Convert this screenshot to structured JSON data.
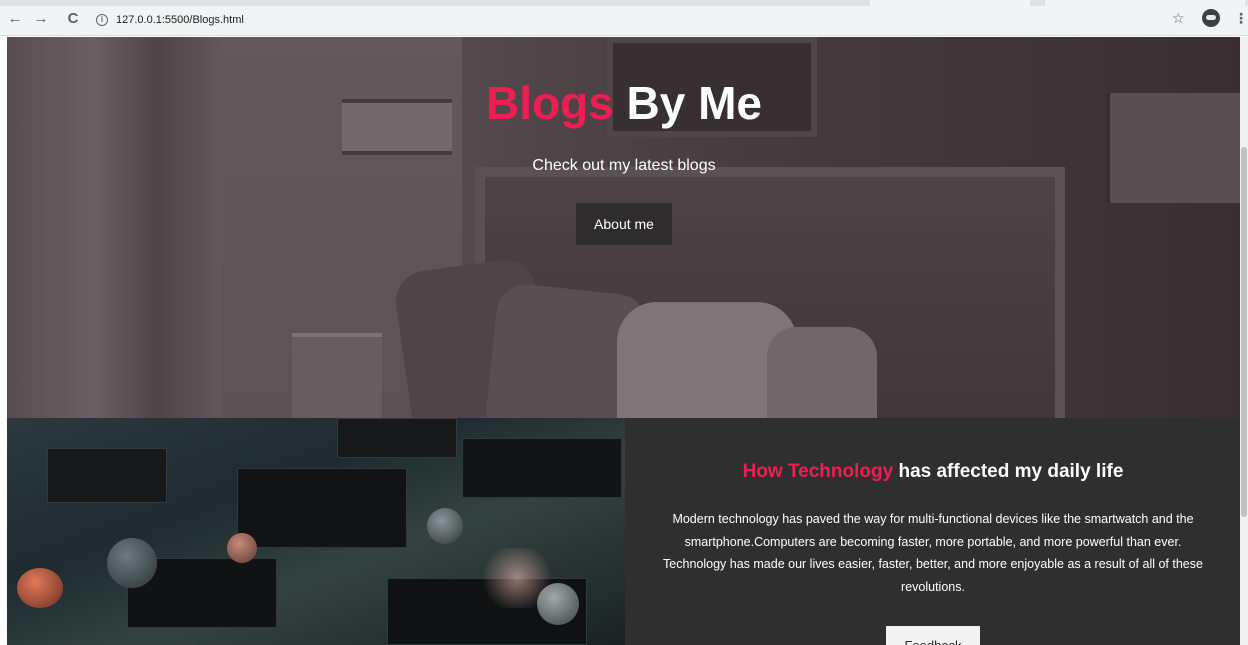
{
  "browser": {
    "url": "127.0.0.1:5500/Blogs.html",
    "back_glyph": "←",
    "forward_glyph": "→",
    "reload_glyph": "C",
    "info_glyph": "i",
    "star_glyph": "☆",
    "menu_glyph": "⋮"
  },
  "hero": {
    "title_accent": "Blogs",
    "title_rest": " By Me",
    "subtitle": "Check out my latest blogs",
    "button_label": "About me"
  },
  "blog": {
    "title_accent": "How Technology",
    "title_rest": " has affected my daily life",
    "text": "Modern technology has paved the way for multi-functional devices like the smartwatch and the smartphone.Computers are becoming faster, more portable, and more powerful than ever. Technology has made our lives easier, faster, better, and more enjoyable as a result of all of these revolutions.",
    "button_label": "Feedback"
  },
  "colors": {
    "accent": "#ee1d52",
    "dark_panel": "#302f30",
    "button_dark": "#2e2c2d"
  }
}
